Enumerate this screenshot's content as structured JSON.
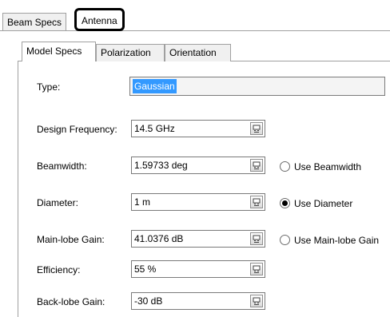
{
  "outer_tabs": [
    {
      "label": "Beam Specs"
    },
    {
      "label": "Antenna"
    }
  ],
  "inner_tabs": [
    {
      "label": "Model Specs"
    },
    {
      "label": "Polarization"
    },
    {
      "label": "Orientation"
    }
  ],
  "form": {
    "type": {
      "label": "Type:",
      "value": "Gaussian"
    },
    "design_frequency": {
      "label": "Design Frequency:",
      "value": "14.5 GHz"
    },
    "beamwidth": {
      "label": "Beamwidth:",
      "value": "1.59733 deg"
    },
    "diameter": {
      "label": "Diameter:",
      "value": "1 m"
    },
    "main_lobe_gain": {
      "label": "Main-lobe Gain:",
      "value": "41.0376 dB"
    },
    "efficiency": {
      "label": "Efficiency:",
      "value": "55 %"
    },
    "back_lobe_gain": {
      "label": "Back-lobe Gain:",
      "value": "-30 dB"
    }
  },
  "radios": {
    "use_beamwidth": {
      "label": "Use Beamwidth",
      "checked": false
    },
    "use_diameter": {
      "label": "Use Diameter",
      "checked": true
    },
    "use_main_lobe_gain": {
      "label": "Use Main-lobe Gain",
      "checked": false
    }
  }
}
